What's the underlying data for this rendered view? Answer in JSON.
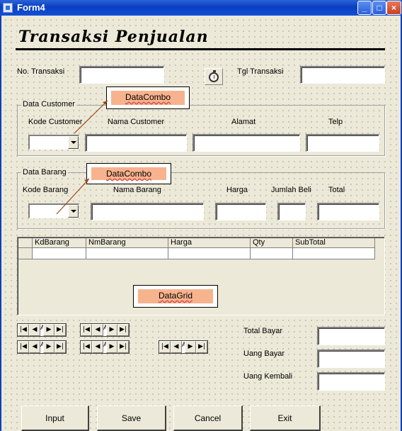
{
  "window": {
    "title": "Form4"
  },
  "form": {
    "heading": "Transaksi Penjualan",
    "no_transaksi_label": "No. Transaksi",
    "no_transaksi_value": "",
    "tgl_transaksi_label": "Tgl Transaksi",
    "tgl_transaksi_value": ""
  },
  "customer": {
    "frame_title": "Data Customer",
    "kode_label": "Kode Customer",
    "nama_label": "Nama Customer",
    "alamat_label": "Alamat",
    "telp_label": "Telp"
  },
  "barang": {
    "frame_title": "Data Barang",
    "kode_label": "Kode Barang",
    "nama_label": "Nama Barang",
    "harga_label": "Harga",
    "jumlah_label": "Jumlah Beli",
    "total_label": "Total"
  },
  "annotations": {
    "customer_combo": "DataCombo",
    "barang_combo": "DataCombo",
    "grid": "DataGrid"
  },
  "grid": {
    "columns": [
      "KdBarang",
      "NmBarang",
      "Harga",
      "Qty",
      "SubTotal"
    ]
  },
  "totals": {
    "total_bayar_label": "Total Bayar",
    "uang_bayar_label": "Uang Bayar",
    "uang_kembali_label": "Uang Kembali"
  },
  "nav": {
    "first": "|◀",
    "prev": "◀",
    "caption": "A",
    "next": "▶",
    "last": "▶|"
  },
  "buttons": {
    "input": "Input",
    "save": "Save",
    "cancel": "Cancel",
    "exit": "Exit"
  },
  "colors": {
    "titlebar": "#0a3fc0",
    "callout_fill": "#f7b38e",
    "arrow": "#9c4a1a",
    "form_bg": "#ece9d8"
  }
}
